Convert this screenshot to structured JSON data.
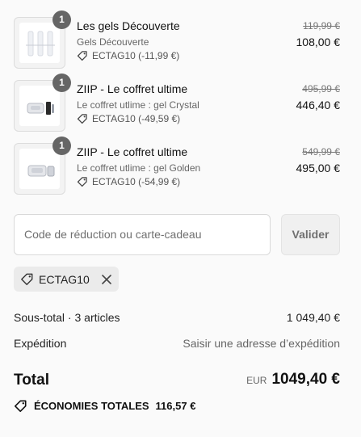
{
  "items": [
    {
      "quantity": "1",
      "title": "Les gels Découverte",
      "variant": "Gels Découverte",
      "discount": "ECTAG10 (-11,99 €)",
      "old_price": "119,99 €",
      "price": "108,00 €",
      "thumbnail_icon": "gel-bottles-image"
    },
    {
      "quantity": "1",
      "title": "ZIIP - Le coffret ultime",
      "variant": "Le coffret utlime : gel Crystal",
      "discount": "ECTAG10 (-49,59 €)",
      "old_price": "495,99 €",
      "price": "446,40 €",
      "thumbnail_icon": "device-kit-image"
    },
    {
      "quantity": "1",
      "title": "ZIIP - Le coffret ultime",
      "variant": "Le coffret utlime : gel Golden",
      "discount": "ECTAG10 (-54,99 €)",
      "old_price": "549,99 €",
      "price": "495,00 €",
      "thumbnail_icon": "device-kit-image"
    }
  ],
  "discount_form": {
    "placeholder": "Code de réduction ou carte-cadeau",
    "value": "",
    "apply_label": "Valider"
  },
  "applied_code": {
    "label": "ECTAG10"
  },
  "summary": {
    "subtotal_label": "Sous-total · 3 articles",
    "subtotal_value": "1 049,40 €",
    "shipping_label": "Expédition",
    "shipping_value": "Saisir une adresse d’expédition",
    "total_label": "Total",
    "currency": "EUR",
    "total_value": "1049,40 €",
    "savings_label": "ÉCONOMIES TOTALES",
    "savings_value": "116,57 €"
  },
  "colors": {
    "background": "#fafafa",
    "quantity_badge": "#666666",
    "muted_text": "#666666",
    "chip_background": "#ebebeb"
  }
}
